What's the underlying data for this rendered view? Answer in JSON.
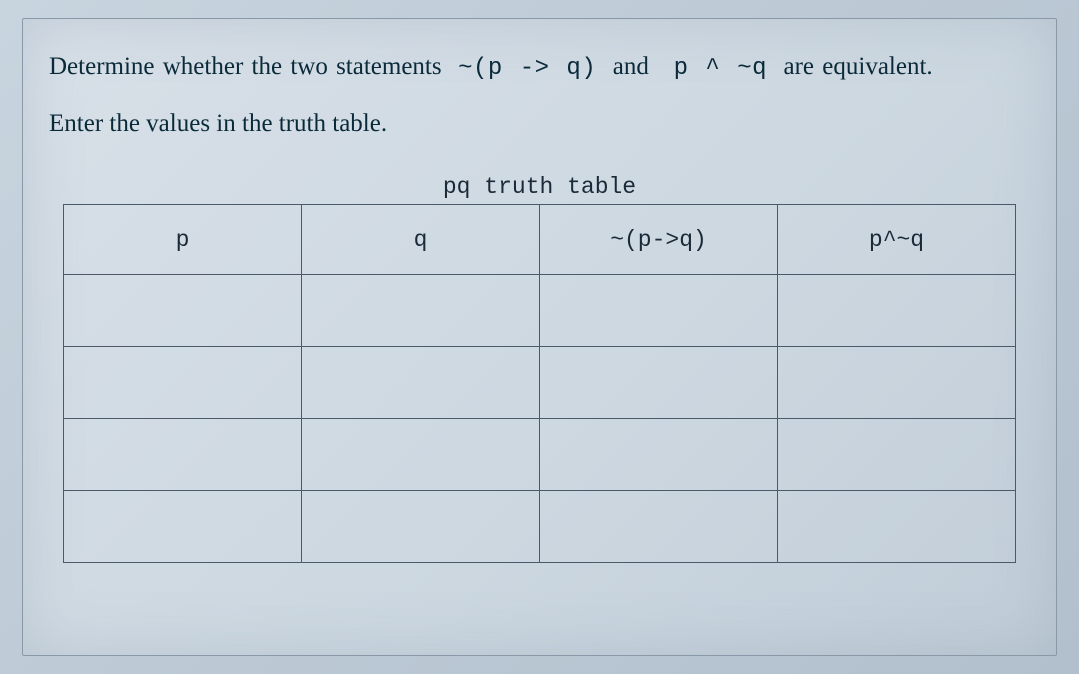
{
  "question": {
    "part1": "Determine whether the two statements",
    "expr1": "~(p -> q)",
    "middle": "and",
    "expr2": "p ^ ~q",
    "part2": "are equivalent."
  },
  "instruction": "Enter the values in the truth table.",
  "table": {
    "caption": "pq truth table",
    "headers": [
      "p",
      "q",
      "~(p->q)",
      "p^~q"
    ],
    "rows": [
      [
        "",
        "",
        "",
        ""
      ],
      [
        "",
        "",
        "",
        ""
      ],
      [
        "",
        "",
        "",
        ""
      ],
      [
        "",
        "",
        "",
        ""
      ]
    ]
  }
}
